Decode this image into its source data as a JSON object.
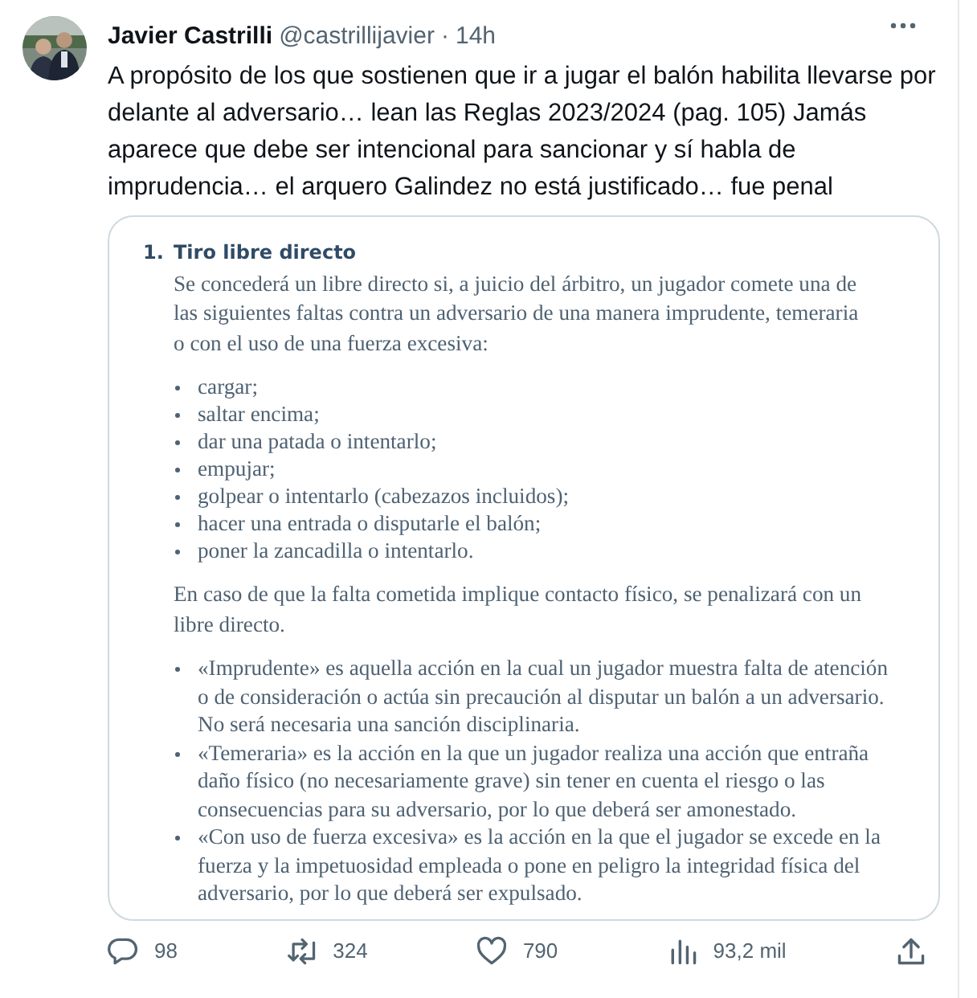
{
  "tweet": {
    "author_name": "Javier Castrilli",
    "handle": "@castrillijavier",
    "separator": "·",
    "time": "14h",
    "text": "A propósito de los que sostienen que ir a jugar el balón habilita llevarse por delante al adversario… lean las Reglas 2023/2024 (pag. 105) Jamás aparece que debe ser intencional para sancionar y sí habla de imprudencia… el arquero Galindez no está justificado… fue penal"
  },
  "document": {
    "number": "1.",
    "title": "Tiro libre directo",
    "blocks": [
      {
        "kind": "paragraph",
        "text": "Se concederá un libre directo si, a juicio del árbitro, un jugador comete una de las siguientes faltas contra un adversario de una manera imprudente, temeraria o con el uso de una fuerza excesiva:"
      },
      {
        "kind": "list",
        "items": [
          "cargar;",
          "saltar encima;",
          "dar una patada o intentarlo;",
          "empujar;",
          "golpear o intentarlo (cabezazos incluidos);",
          "hacer una entrada o disputarle el balón;",
          "poner la zancadilla o intentarlo."
        ]
      },
      {
        "kind": "paragraph",
        "text": "En caso de que la falta cometida implique contacto físico, se penalizará con un libre directo."
      },
      {
        "kind": "list",
        "items": [
          "«Imprudente» es aquella acción en la cual un jugador muestra falta de atención o de consideración o actúa sin precaución al disputar un balón a un adversario. No será necesaria una sanción disciplinaria.",
          "«Temeraria» es la acción en la que un jugador realiza una acción que entraña daño físico (no necesariamente grave) sin tener en cuenta el riesgo o las consecuencias para su adversario, por lo que deberá ser amonestado.",
          "«Con uso de fuerza excesiva» es la acción en la que el jugador se excede en la fuerza y la impetuosidad empleada o pone en peligro la integridad física del adversario, por lo que deberá ser expulsado."
        ]
      }
    ]
  },
  "actions": [
    {
      "kind": "reply",
      "count": "98"
    },
    {
      "kind": "retweet",
      "count": "324"
    },
    {
      "kind": "like",
      "count": "790"
    },
    {
      "kind": "views",
      "count": "93,2 mil"
    },
    {
      "kind": "share"
    }
  ]
}
